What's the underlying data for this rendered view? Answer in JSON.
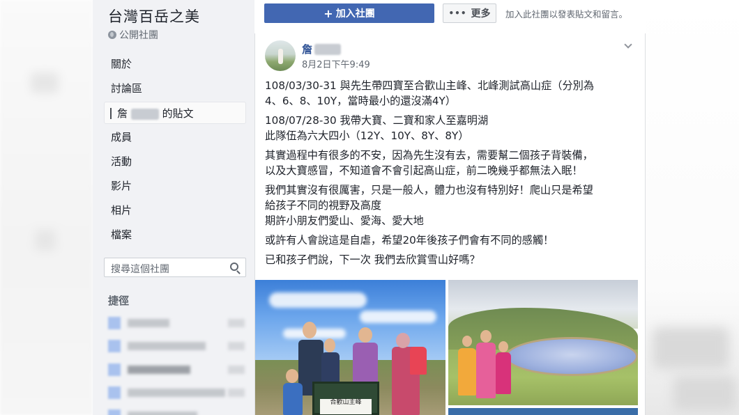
{
  "group": {
    "name": "台灣百岳之美",
    "type": "公開社團"
  },
  "nav": {
    "items": [
      {
        "label": "關於"
      },
      {
        "label": "討論區"
      },
      {
        "label_prefix": "詹",
        "label_suffix": "的貼文",
        "active": true
      },
      {
        "label": "成員"
      },
      {
        "label": "活動"
      },
      {
        "label": "影片"
      },
      {
        "label": "相片"
      },
      {
        "label": "檔案"
      }
    ]
  },
  "search": {
    "placeholder": "搜尋這個社團"
  },
  "shortcuts": {
    "title": "捷徑"
  },
  "actions": {
    "join_label": "加入社團",
    "join_icon": "plus-icon",
    "more_label": "更多",
    "more_icon": "dots-icon",
    "join_hint": "加入此社團以發表貼文和留言。"
  },
  "post": {
    "author": "詹",
    "timestamp": "8月2日下午9:49",
    "paragraphs": [
      "108/03/30-31 與先生帶四寶至合歡山主峰、北峰測試高山症（分別為\n4、6、8、10Y，當時最小的還沒滿4Y）",
      "108/07/28-30 我帶大寶、二寶和家人至嘉明湖\n此隊伍為六大四小（12Y、10Y、8Y、8Y）",
      "其實過程中有很多的不安，因為先生沒有去，需要幫二個孩子背裝備，\n以及大寶感冒，不知道會不會引起高山症，前二晚幾乎都無法入眠！",
      "我們其實沒有很厲害，只是一般人，體力也沒有特別好！爬山只是希望\n給孩子不同的視野及高度\n期許小朋友們愛山、愛海、愛大地",
      "或許有人會說這是自虐，希望20年後孩子們會有不同的感觸！",
      "已和孩子們說，下一次 我們去欣賞雪山好嗎？"
    ],
    "photo_sign_text": "合歡山主峰"
  },
  "colors": {
    "accent": "#4267b2",
    "link": "#365899",
    "sidebar_bg": "#f1f2f5"
  }
}
